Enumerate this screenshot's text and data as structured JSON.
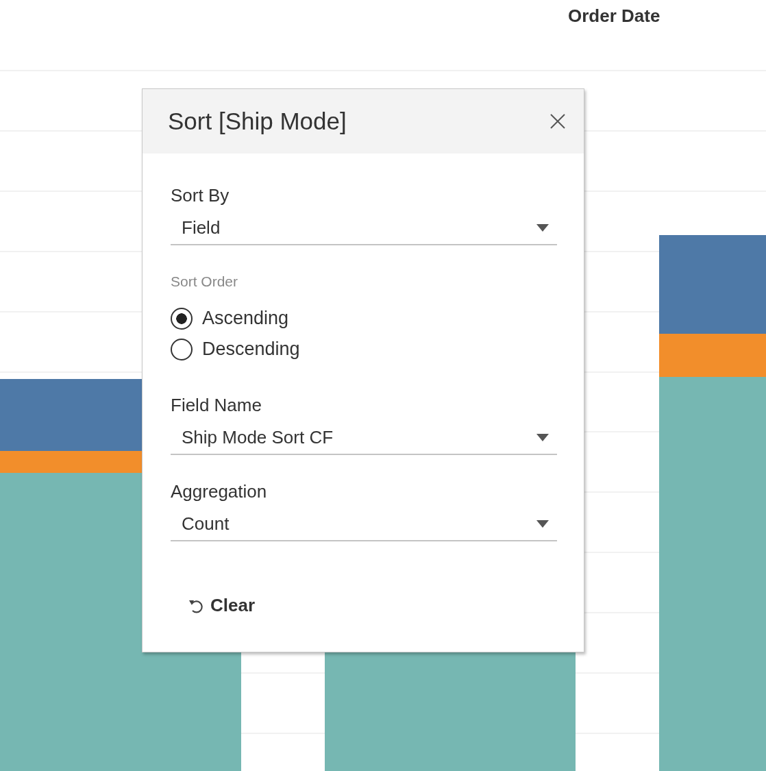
{
  "header": {
    "title": "Order Date"
  },
  "dialog": {
    "title": "Sort [Ship Mode]",
    "sort_by": {
      "label": "Sort By",
      "value": "Field"
    },
    "sort_order": {
      "label": "Sort Order",
      "options": [
        {
          "label": "Ascending",
          "selected": true
        },
        {
          "label": "Descending",
          "selected": false
        }
      ]
    },
    "field_name": {
      "label": "Field Name",
      "value": "Ship Mode Sort CF"
    },
    "aggregation": {
      "label": "Aggregation",
      "value": "Count"
    },
    "clear_button": {
      "label": "Clear"
    }
  }
}
